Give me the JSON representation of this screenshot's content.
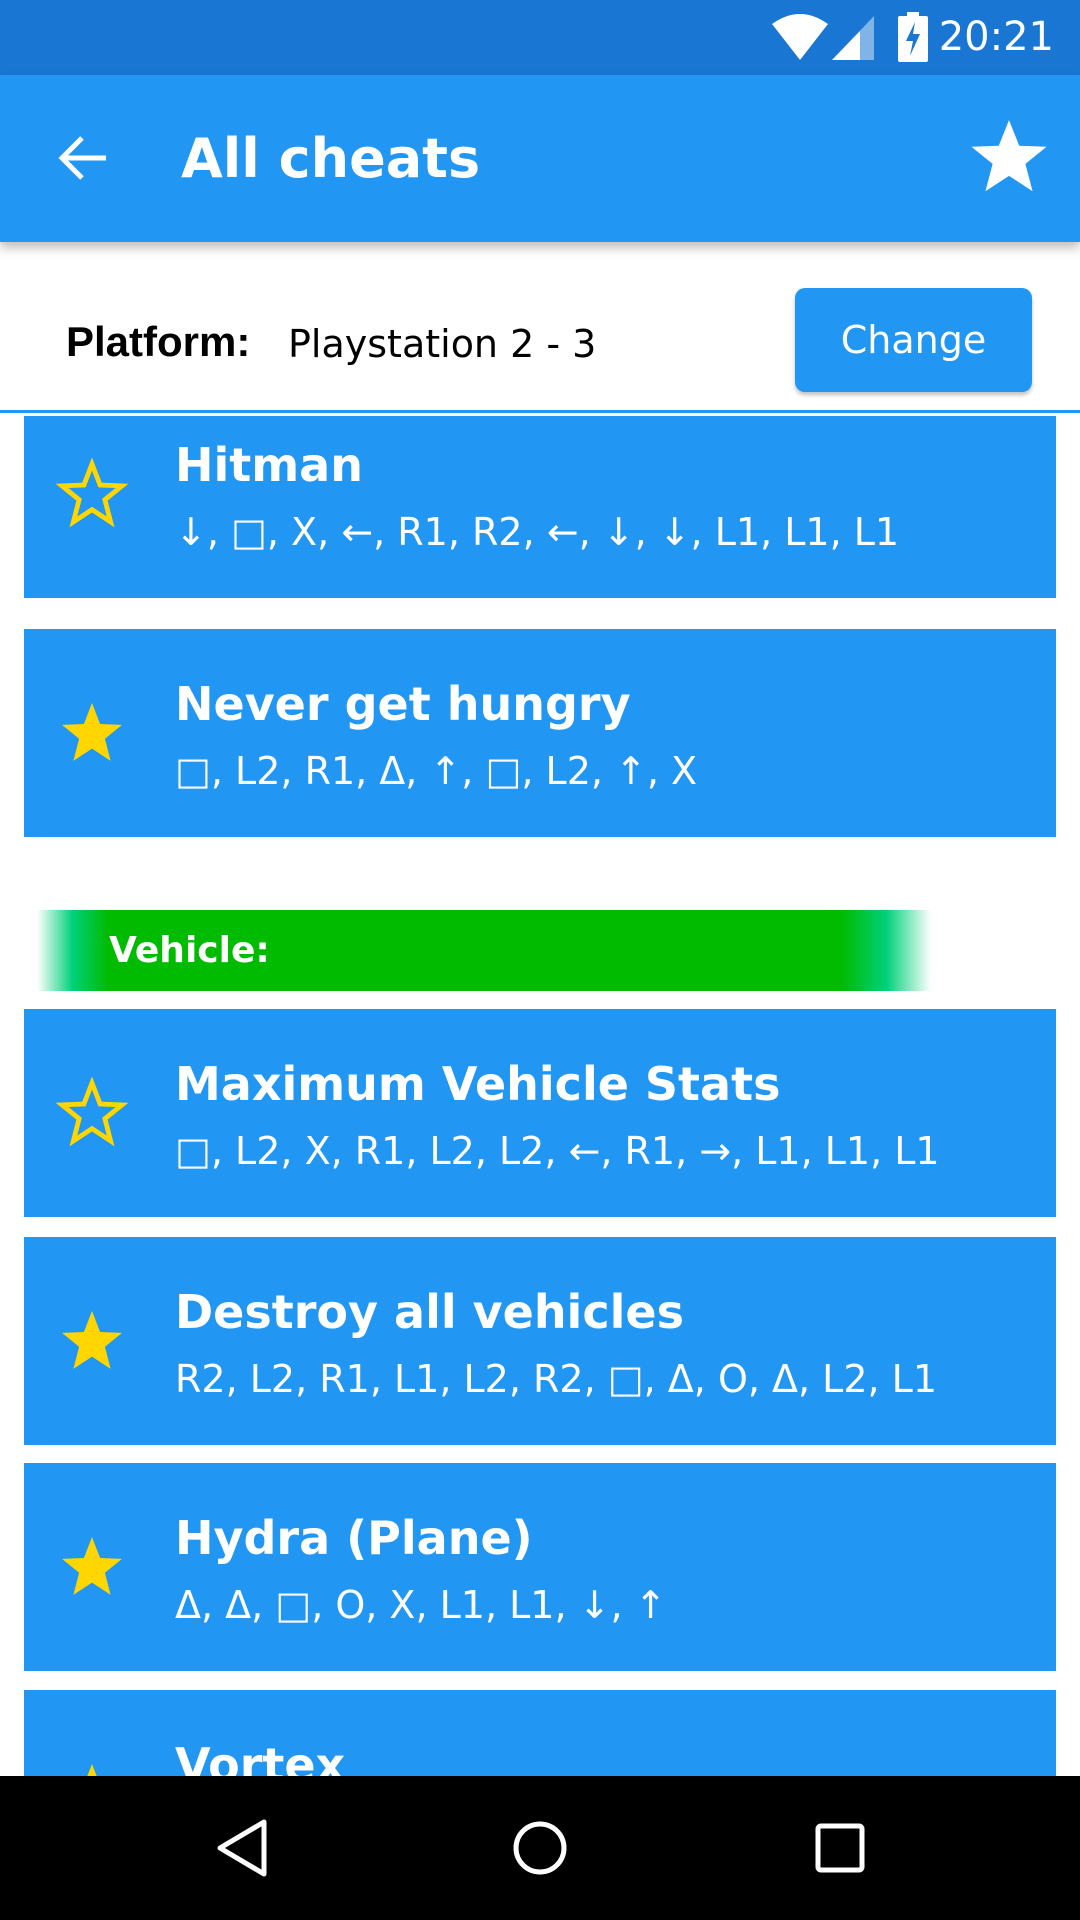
{
  "status_bar": {
    "time": "20:21",
    "icons": [
      "wifi-icon",
      "signal-icon",
      "battery-charging-icon"
    ]
  },
  "app_bar": {
    "title": "All cheats",
    "back_icon": "arrow-left-icon",
    "favorites_icon": "star-icon"
  },
  "platform": {
    "label": "Platform:",
    "value": "Playstation 2 - 3",
    "change_label": "Change"
  },
  "colors": {
    "primary": "#2196F3",
    "status": "#1976D2",
    "star": "#FFD600",
    "section": "#00BB00"
  },
  "cheats_top": [
    {
      "title": "Hitman",
      "code": "↓, □, X, ←, R1, R2, ←, ↓, ↓, L1, L1, L1",
      "favorite": false
    },
    {
      "title": "Never get hungry",
      "code": "□, L2, R1, Δ, ↑, □, L2, ↑, X",
      "favorite": true
    }
  ],
  "section": {
    "label": "Vehicle:"
  },
  "cheats_vehicle": [
    {
      "title": "Maximum Vehicle Stats",
      "code": "□, L2, X, R1, L2, L2, ←, R1, →, L1, L1, L1",
      "favorite": false
    },
    {
      "title": "Destroy all vehicles",
      "code": "R2, L2, R1, L1, L2, R2, □, Δ, O, Δ, L2, L1",
      "favorite": true
    },
    {
      "title": "Hydra (Plane)",
      "code": "Δ, Δ, □, O, X, L1, L1, ↓, ↑",
      "favorite": true
    },
    {
      "title": "Vortex",
      "code": "",
      "favorite": true
    }
  ],
  "nav_bar": {
    "icons": [
      "back-triangle-icon",
      "home-circle-icon",
      "recents-square-icon"
    ]
  }
}
